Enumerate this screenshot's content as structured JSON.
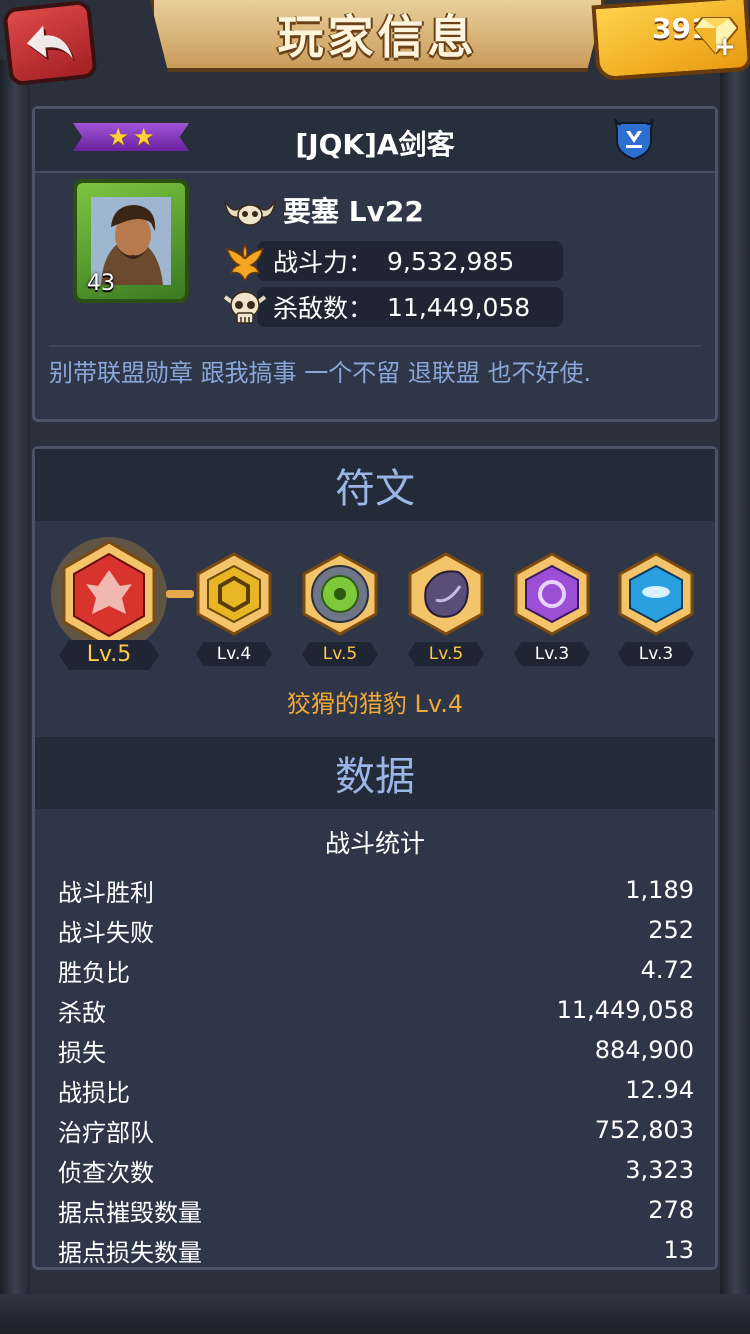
{
  "header": {
    "title": "玩家信息",
    "gems": "391"
  },
  "player": {
    "stars": 2,
    "name": "[JQK]A剑客",
    "portrait_level": "43",
    "fortress_label": "要塞 Lv22",
    "power_label": "战斗力：",
    "power_value": "9,532,985",
    "kills_label": "杀敌数：",
    "kills_value": "11,449,058",
    "motto": "别带联盟勋章 跟我搞事 一个不留 退联盟 也不好使."
  },
  "runes": {
    "title": "符文",
    "items": [
      {
        "level": "Lv.5",
        "color": "#d8332c"
      },
      {
        "level": "Lv.4",
        "color": "#e8b624"
      },
      {
        "level": "Lv.5",
        "color": "#7dc93a"
      },
      {
        "level": "Lv.5",
        "color": "#5a4d78"
      },
      {
        "level": "Lv.3",
        "color": "#9a4fd4"
      },
      {
        "level": "Lv.3",
        "color": "#2a9fe0"
      }
    ],
    "set_name": "狡猾的猎豹 Lv.4"
  },
  "data_section": {
    "title": "数据",
    "subtitle": "战斗统计",
    "rows": [
      {
        "label": "战斗胜利",
        "value": "1,189"
      },
      {
        "label": "战斗失败",
        "value": "252"
      },
      {
        "label": "胜负比",
        "value": "4.72"
      },
      {
        "label": "杀敌",
        "value": "11,449,058"
      },
      {
        "label": "损失",
        "value": "884,900"
      },
      {
        "label": "战损比",
        "value": "12.94"
      },
      {
        "label": "治疗部队",
        "value": "752,803"
      },
      {
        "label": "侦查次数",
        "value": "3,323"
      },
      {
        "label": "据点摧毁数量",
        "value": "278"
      },
      {
        "label": "据点损失数量",
        "value": "13"
      }
    ]
  },
  "colors": {
    "accent_gold": "#f0a838",
    "section_title": "#9bb6e6",
    "motto": "#8aa6d9",
    "panel": "#2e3647"
  },
  "icons": {
    "back": "back-arrow-icon",
    "gem": "diamond-icon",
    "fortress": "horned-skull-icon",
    "power": "phoenix-icon",
    "kills": "skull-icon",
    "guild": "shield-icon"
  }
}
